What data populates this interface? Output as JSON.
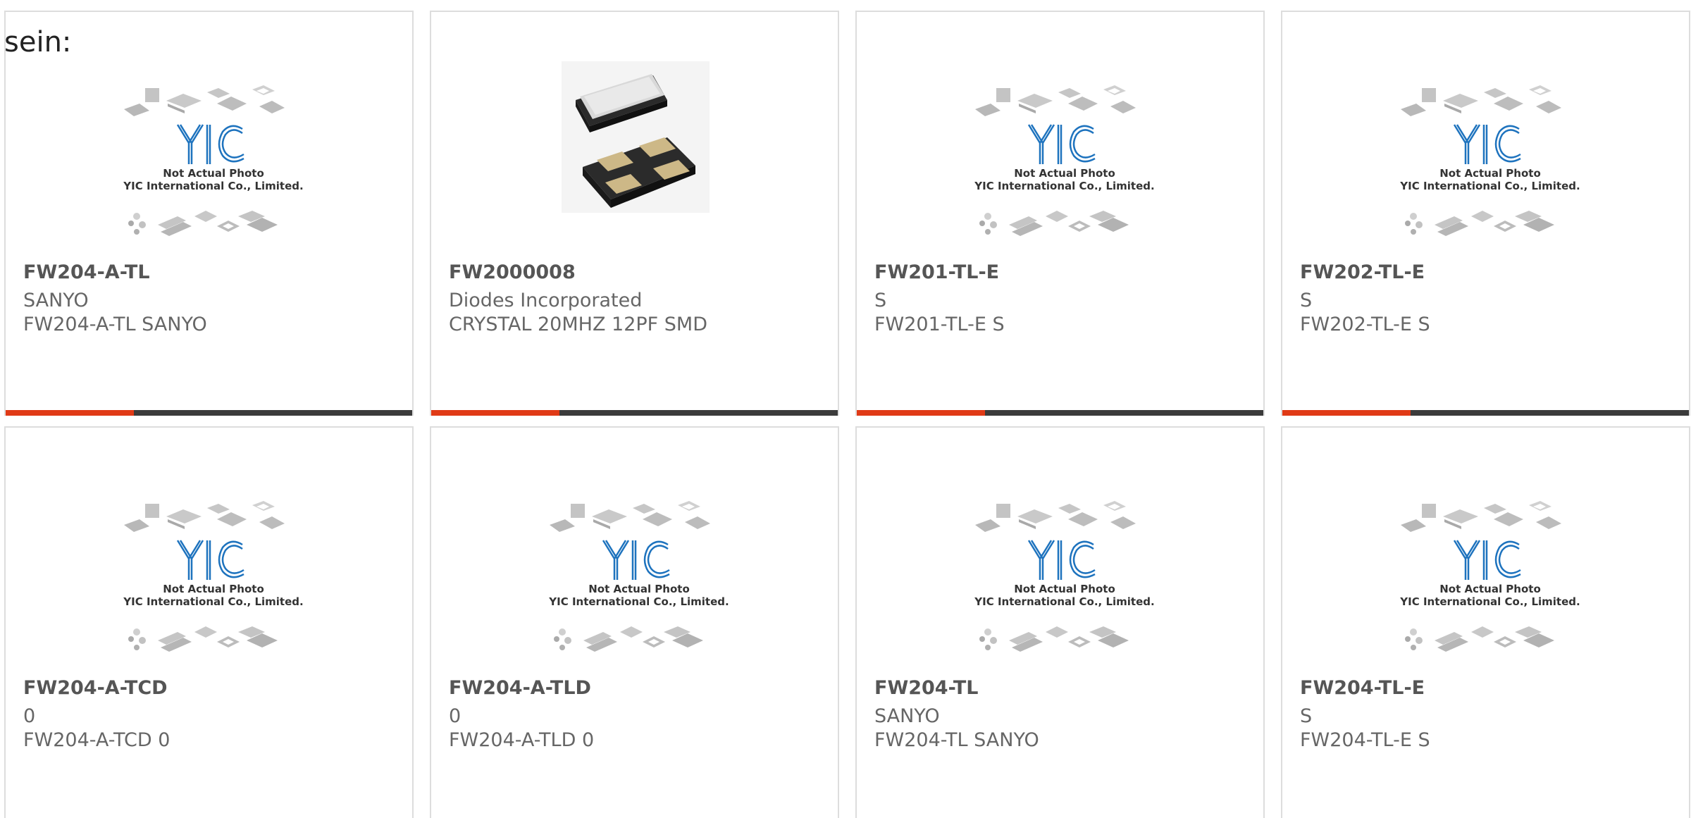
{
  "lead_text": "sein:",
  "placeholder_image": {
    "line1": "Not Actual Photo",
    "line2": "YIC International Co., Limited.",
    "logo_text": "YIC"
  },
  "colors": {
    "accent": "#e03a16",
    "bar": "#3b3b3b",
    "title": "#555555",
    "text": "#666666",
    "logo_blue": "#1e73be"
  },
  "products": [
    {
      "title": "FW204-A-TL",
      "manufacturer": "SANYO",
      "description": "FW204-A-TL SANYO",
      "image": "yic-placeholder-icon"
    },
    {
      "title": "FW2000008",
      "manufacturer": "Diodes Incorporated",
      "description": "CRYSTAL 20MHZ 12PF SMD",
      "image": "crystal-photo-icon"
    },
    {
      "title": "FW201-TL-E",
      "manufacturer": "S",
      "description": "FW201-TL-E S",
      "image": "yic-placeholder-icon"
    },
    {
      "title": "FW202-TL-E",
      "manufacturer": "S",
      "description": "FW202-TL-E S",
      "image": "yic-placeholder-icon"
    },
    {
      "title": "FW204-A-TCD",
      "manufacturer": "0",
      "description": "FW204-A-TCD 0",
      "image": "yic-placeholder-icon"
    },
    {
      "title": "FW204-A-TLD",
      "manufacturer": "0",
      "description": "FW204-A-TLD 0",
      "image": "yic-placeholder-icon"
    },
    {
      "title": "FW204-TL",
      "manufacturer": "SANYO",
      "description": "FW204-TL SANYO",
      "image": "yic-placeholder-icon"
    },
    {
      "title": "FW204-TL-E",
      "manufacturer": "S",
      "description": "FW204-TL-E S",
      "image": "yic-placeholder-icon"
    }
  ]
}
